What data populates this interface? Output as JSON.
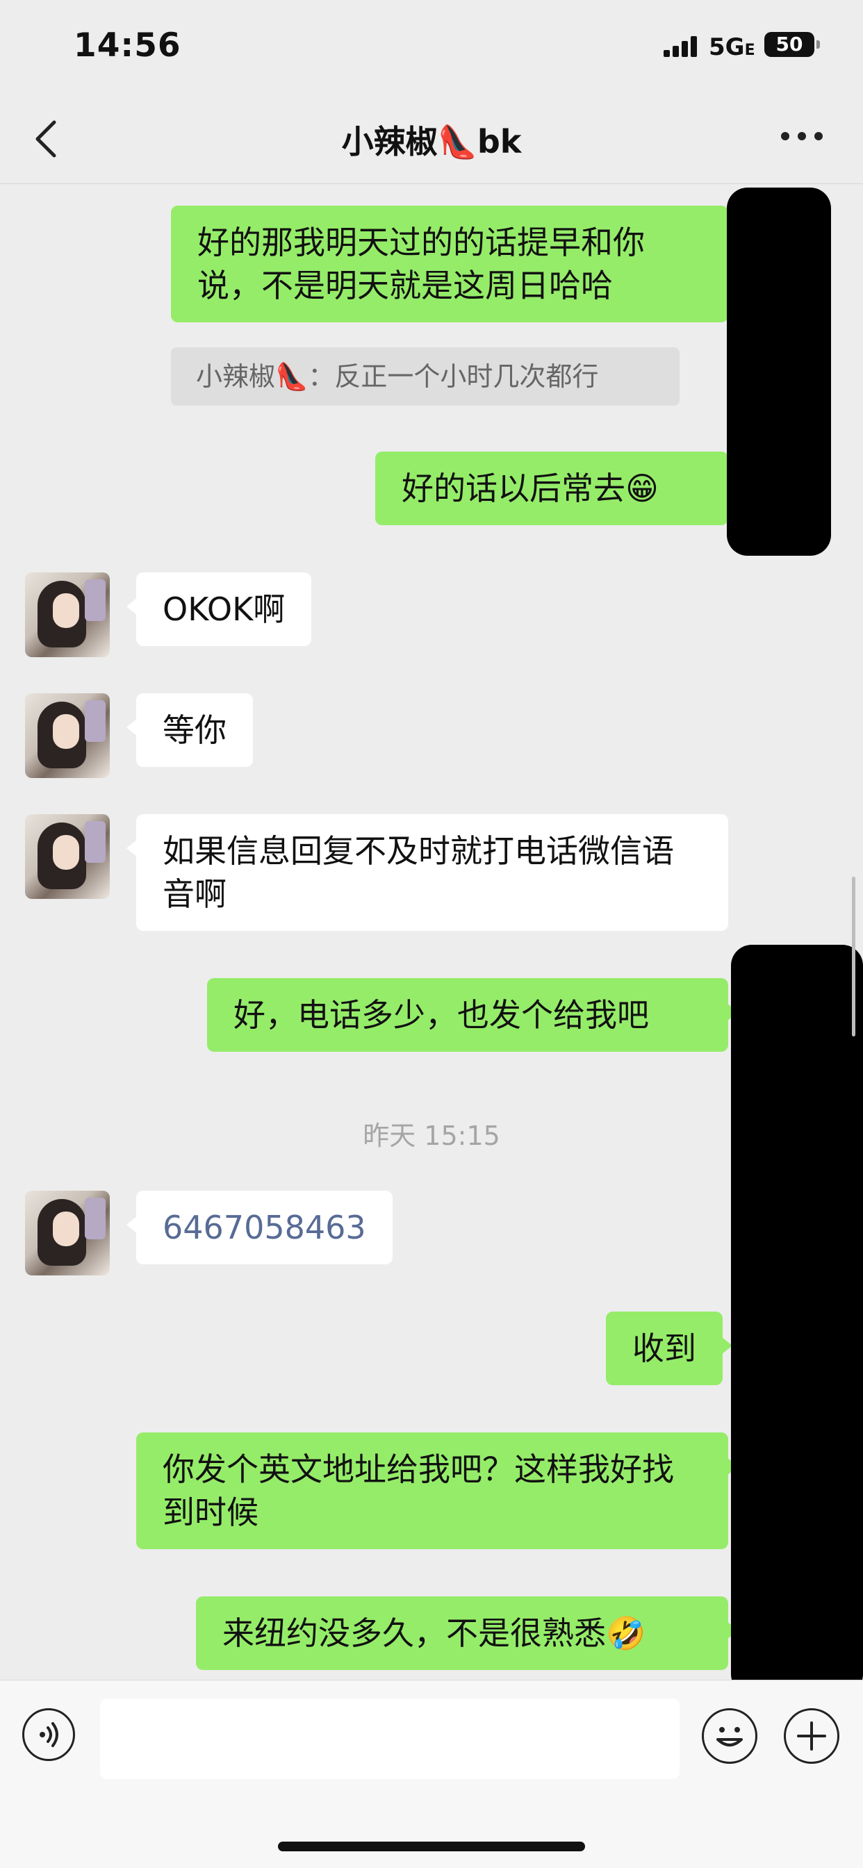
{
  "status_bar": {
    "time": "14:56",
    "network": "5G",
    "network_suffix": "E",
    "battery": "50"
  },
  "header": {
    "title": "小辣椒👠bk",
    "back_icon": "chevron-left-icon",
    "more_icon": "ellipsis-icon"
  },
  "messages": [
    {
      "side": "out",
      "text": "好的那我明天过的的话提早和你说，不是明天就是这周日哈哈"
    },
    {
      "type": "quote",
      "text": "小辣椒👠：反正一个小时几次都行"
    },
    {
      "side": "out",
      "text": "好的话以后常去😁"
    },
    {
      "side": "in",
      "text": "OKOK啊"
    },
    {
      "side": "in",
      "text": "等你"
    },
    {
      "side": "in",
      "text": "如果信息回复不及时就打电话微信语音啊"
    },
    {
      "side": "out",
      "text": "好，电话多少，也发个给我吧"
    },
    {
      "type": "timestamp",
      "text": "昨天 15:15"
    },
    {
      "side": "in",
      "text": "6467058463"
    },
    {
      "side": "out",
      "text": "收到"
    },
    {
      "side": "out",
      "text": "你发个英文地址给我吧？这样我好找到时候"
    },
    {
      "side": "out",
      "text": "来纽约没多久，不是很熟悉🤣"
    }
  ],
  "input_bar": {
    "voice_icon": "voice-icon",
    "emoji_icon": "emoji-icon",
    "plus_icon": "plus-icon",
    "text": ""
  },
  "colors": {
    "outgoing": "#95ec69",
    "incoming": "#ffffff",
    "background": "#ededed",
    "link": "#576b95"
  }
}
